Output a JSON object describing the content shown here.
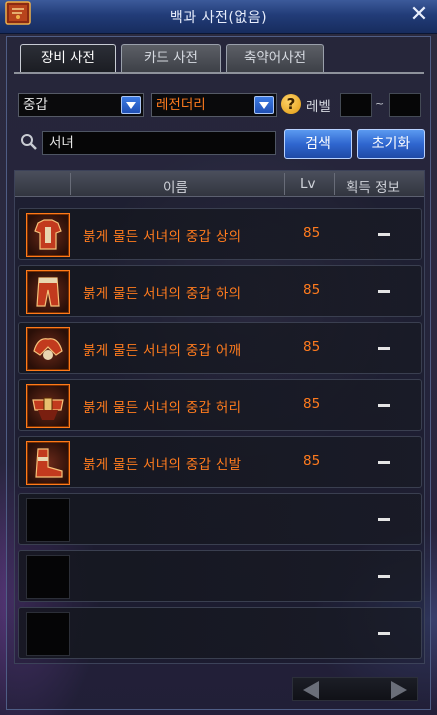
{
  "window": {
    "title": "백과 사전(없음)",
    "close_glyph": "✕"
  },
  "tabs": [
    {
      "label": "장비 사전",
      "active": true
    },
    {
      "label": "카드 사전",
      "active": false
    },
    {
      "label": "축약어사전",
      "active": false
    }
  ],
  "filters": {
    "category_value": "중갑",
    "rarity_value": "레전더리",
    "rarity_color": "#ff7b1e",
    "help_glyph": "?",
    "level_label": "레벨",
    "level_from": "",
    "level_to": "",
    "level_sep": "~"
  },
  "search": {
    "value": "서녀",
    "search_button": "검색",
    "reset_button": "초기화"
  },
  "list": {
    "headers": {
      "name": "이름",
      "lv": "Lv",
      "acquire": "획득 정보"
    },
    "rows": [
      {
        "name": "붉게 물든 서녀의 중갑 상의",
        "lv": "85",
        "icon": "armor-top-icon"
      },
      {
        "name": "붉게 물든 서녀의 중갑 하의",
        "lv": "85",
        "icon": "armor-bottom-icon"
      },
      {
        "name": "붉게 물든 서녀의 중갑 어깨",
        "lv": "85",
        "icon": "armor-shoulder-icon"
      },
      {
        "name": "붉게 물든 서녀의 중갑 허리",
        "lv": "85",
        "icon": "armor-belt-icon"
      },
      {
        "name": "붉게 물든 서녀의 중갑 신발",
        "lv": "85",
        "icon": "armor-shoes-icon"
      },
      {
        "name": "",
        "lv": "",
        "icon": "empty-slot"
      },
      {
        "name": "",
        "lv": "",
        "icon": "empty-slot"
      },
      {
        "name": "",
        "lv": "",
        "icon": "empty-slot"
      }
    ]
  },
  "colors": {
    "accent_blue": "#2f66cf",
    "legendary_orange": "#ff7b1e"
  }
}
